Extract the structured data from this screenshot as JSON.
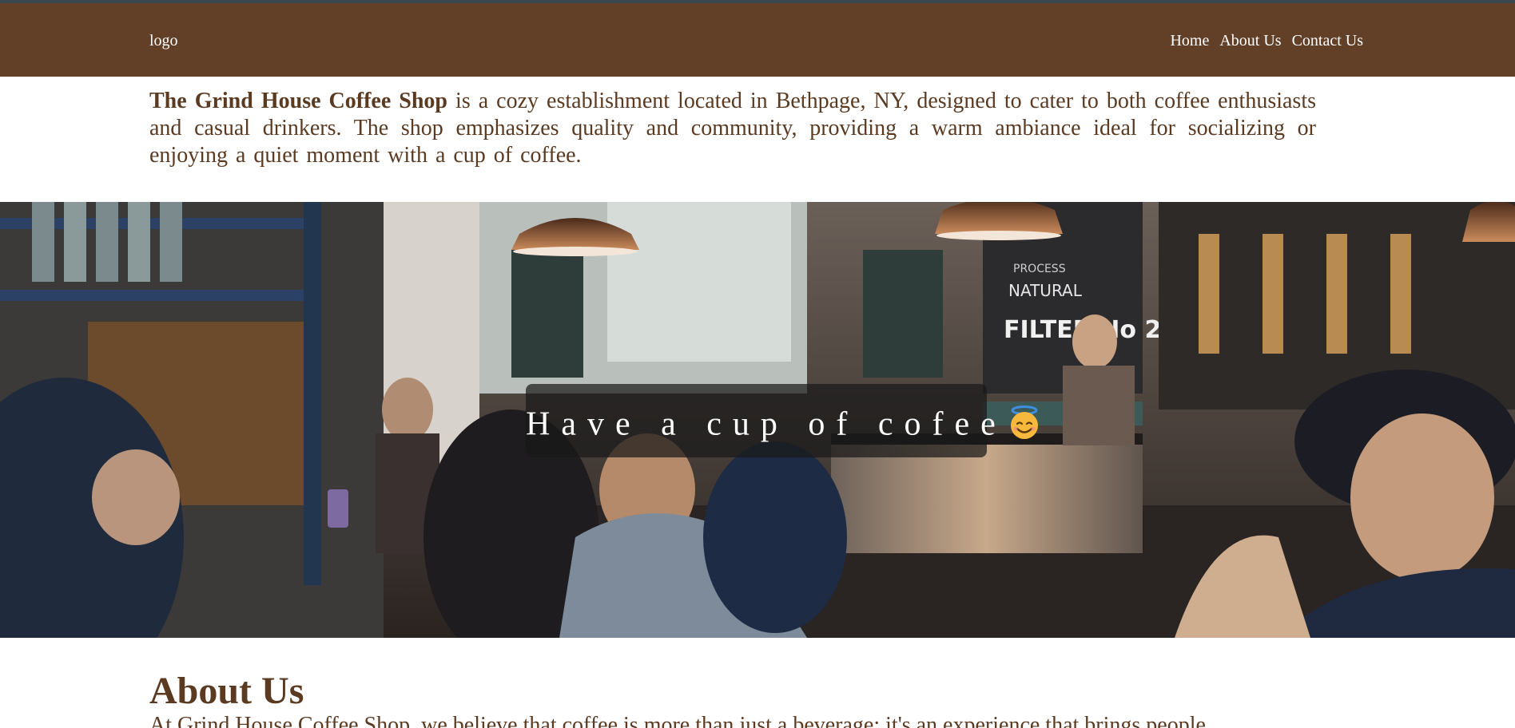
{
  "header": {
    "logo": "logo",
    "nav": [
      "Home",
      "About Us",
      "Contact Us"
    ]
  },
  "intro": {
    "shop_name": "The Grind House Coffee Shop",
    "text": " is a cozy establishment located in Bethpage, NY, designed to cater to both coffee enthusiasts and casual drinkers. The shop emphasizes quality and community, providing a warm ambiance ideal for socializing or enjoying a quiet moment with a cup of coffee."
  },
  "hero": {
    "tagline": "Have a cup of cofee",
    "emoji": "smiling-face-with-halo-icon",
    "chalkboard": [
      "NATURAL",
      "FILTER No 2",
      "PROCESS"
    ]
  },
  "about": {
    "title": "About Us",
    "text": "At Grind House Coffee Shop, we believe that coffee is more than just a beverage; it's an experience that brings people"
  },
  "colors": {
    "brand_brown": "#623f27",
    "text_brown": "#5b3a22",
    "topline": "#3a4650"
  }
}
